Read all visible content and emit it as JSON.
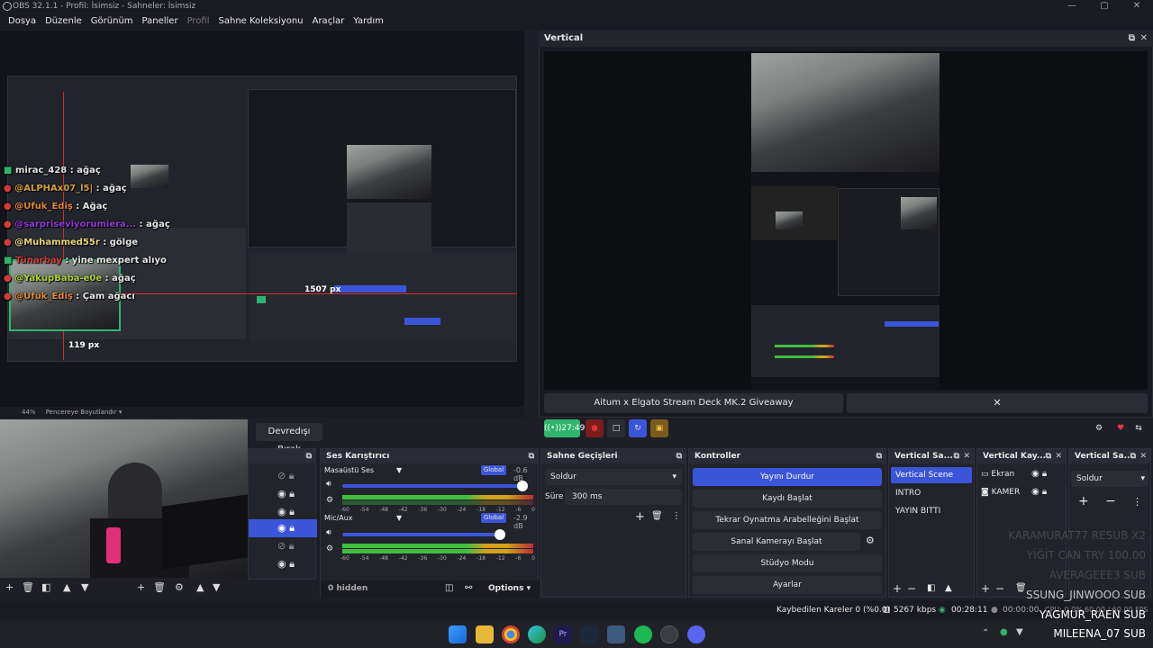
{
  "window": {
    "title": "OBS 32.1.1 - Profil: İsimsiz - Sahneler: İsimsiz"
  },
  "menu": [
    "Dosya",
    "Düzenle",
    "Görünüm",
    "Paneller",
    "Profil",
    "Sahne Koleksiyonu",
    "Araçlar",
    "Yardım"
  ],
  "preview": {
    "measure_horizontal": "1507 px",
    "measure_vertical": "119 px",
    "zoom": "44%",
    "fit_label": "Pencereye Boyutlandır"
  },
  "chat": [
    {
      "user": "mirac_428",
      "msg": " : ağaç",
      "color": "#ffffff"
    },
    {
      "user": "@ALPHAx07_l5|",
      "msg": " : ağaç",
      "color": "#d4a23a"
    },
    {
      "user": "@Ufuk_Ediş",
      "msg": " : Ağaç",
      "color": "#e0883a"
    },
    {
      "user": "@sarpriseviyorumiera...",
      "msg": " : ağaç",
      "color": "#8e3ad4"
    },
    {
      "user": "@Muhammed55r",
      "msg": " : gölge",
      "color": "#e7d77a"
    },
    {
      "user": "Tünarbay",
      "msg": " : yine mexpert alıyo",
      "color": "#d43a3a"
    },
    {
      "user": "@YakupBaba-e0e",
      "msg": " : ağaç",
      "color": "#b0d43a"
    },
    {
      "user": "@Ufuk_Ediş",
      "msg": " : Çam ağacı",
      "color": "#e0883a"
    }
  ],
  "vertical": {
    "title": "Vertical",
    "giveaway": "Aitum x Elgato Stream Deck MK.2 Giveaway",
    "close_glyph": "✕",
    "live_time": "27:49"
  },
  "devredisi": "Devredışı Bırak",
  "audio_mixer": {
    "title": "Ses Karıştırıcı",
    "channels": [
      {
        "name": "Masaüstü Ses",
        "tag": "Global",
        "db": "-0.6 dB",
        "level": 0.98
      },
      {
        "name": "Mic/Aux",
        "tag": "Global",
        "db": "-2.9 dB",
        "level": 0.86
      }
    ],
    "scale": [
      "-60",
      "-54",
      "-48",
      "-42",
      "-36",
      "-30",
      "-24",
      "-18",
      "-12",
      "-6",
      "0"
    ],
    "hidden": "0 hidden",
    "options": "Options"
  },
  "transitions": {
    "title": "Sahne Geçişleri",
    "selected": "Soldur",
    "duration_label": "Süre",
    "duration": "300 ms"
  },
  "controls": {
    "title": "Kontroller",
    "buttons": [
      "Yayını Durdur",
      "Kaydı Başlat",
      "Tekrar Oynatma Arabelleğini Başlat",
      "Sanal Kamerayı Başlat",
      "Stüdyo Modu",
      "Ayarlar"
    ]
  },
  "vscenes": {
    "title": "Vertical Sa...",
    "items": [
      "Vertical Scene",
      "INTRO",
      "YAYIN BITTI"
    ]
  },
  "vsources": {
    "title": "Vertical Kay...",
    "items": [
      "Ekran",
      "KAMER"
    ]
  },
  "vtrans": {
    "title": "Vertical Sa...",
    "selected": "Soldur"
  },
  "subs_overlay": [
    {
      "text": "KARAMURAT77  RESUB X2",
      "opacity": 0.35
    },
    {
      "text": "YİĞİT CAN  TRY 100.00",
      "opacity": 0.35
    },
    {
      "text": "AVERAGEEE3  SUB",
      "opacity": 0.35
    },
    {
      "text": "SSUNG_JINWOOO  SUB",
      "opacity": 0.85
    },
    {
      "text": "YAGMUR_RAEN  SUB",
      "opacity": 1
    },
    {
      "text": "MILEENA_07  SUB",
      "opacity": 1
    }
  ],
  "status": {
    "dropped": "Kaybedilen Kareler 0 (%0.0)",
    "bitrate": "5267 kbps",
    "stream_time": "00:28:11",
    "rec_time": "00:00:00",
    "cpu": "CPU: 0.0%",
    "fps": "60.00 / 60.00 FPS"
  },
  "colors": {
    "accent": "#3a55d8",
    "live": "#2fb56b",
    "bg": "#1e1f26"
  }
}
